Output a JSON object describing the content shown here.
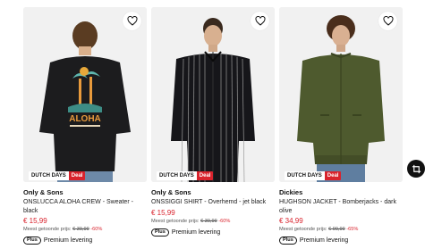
{
  "products": [
    {
      "badge_event": "DUTCH DAYS",
      "badge_deal": "Deal",
      "brand": "Only & Sons",
      "title": "ONSLUCCA ALOHA CREW - Sweater - black",
      "price": "€ 15,99",
      "lowest_label": "Meest getoonde prijs:",
      "lowest_price": "€ 39,99",
      "discount": "-60%",
      "plus_badge": "Plus",
      "delivery": "Premium levering",
      "print_text": "ALOHA"
    },
    {
      "badge_event": "DUTCH DAYS",
      "badge_deal": "Deal",
      "brand": "Only & Sons",
      "title": "ONSSIGGI SHIRT - Overhemd - jet black",
      "price": "€ 15,99",
      "lowest_label": "Meest getoonde prijs:",
      "lowest_price": "€ 39,99",
      "discount": "-60%",
      "plus_badge": "Plus",
      "delivery": "Premium levering"
    },
    {
      "badge_event": "DUTCH DAYS",
      "badge_deal": "Deal",
      "brand": "Dickies",
      "title": "HUGHSON JACKET - Bomberjacks - dark olive",
      "price": "€ 34,99",
      "lowest_label": "Meest getoonde prijs:",
      "lowest_price": "€ 99,99",
      "discount": "-65%",
      "plus_badge": "Plus",
      "delivery": "Premium levering"
    }
  ],
  "icons": {
    "wishlist": "heart-outline-icon",
    "crop": "crop-icon"
  },
  "colors": {
    "accent_red": "#d9232d",
    "photo_bg": "#f1f1f1"
  }
}
